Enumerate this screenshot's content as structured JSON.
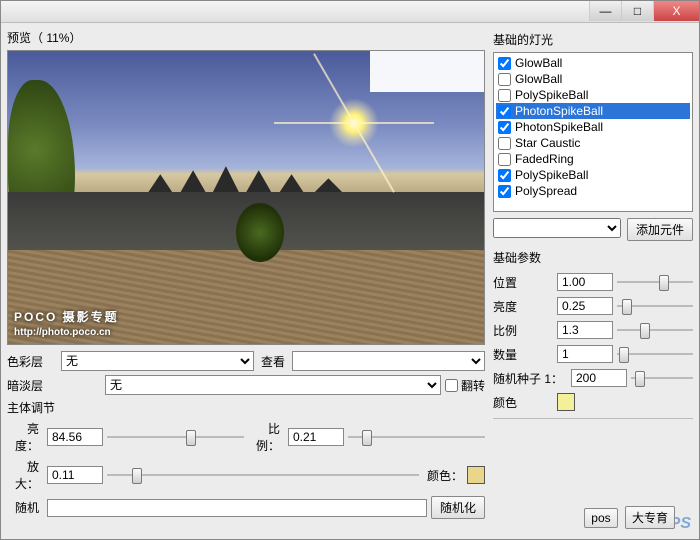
{
  "titlebar": {
    "minimize": "—",
    "maximize": "□",
    "close": "X"
  },
  "left": {
    "preview_label": "预览（  11%）",
    "watermark_title": "POCO 摄影专题",
    "watermark_url": "http://photo.poco.cn",
    "color_layer_label": "色彩层",
    "color_layer_value": "无",
    "view_label": "查看",
    "dim_layer_label": "暗淡层",
    "dim_layer_value": "无",
    "flip_label": "翻转",
    "main_adjust_label": "主体调节",
    "brightness_label": "亮度：",
    "brightness_value": "84.56",
    "ratio_label": "比例：",
    "ratio_value": "0.21",
    "zoom_label": "放大：",
    "zoom_value": "0.11",
    "color_label": "颜色：",
    "color_swatch": "#e9d68b",
    "random_label": "随机",
    "randomize_btn": "随机化"
  },
  "right": {
    "panel_title": "基础的灯光",
    "lights": [
      {
        "checked": true,
        "label": "GlowBall",
        "selected": false
      },
      {
        "checked": false,
        "label": "GlowBall",
        "selected": false
      },
      {
        "checked": false,
        "label": "PolySpikeBall",
        "selected": false
      },
      {
        "checked": true,
        "label": "PhotonSpikeBall",
        "selected": true
      },
      {
        "checked": true,
        "label": "PhotonSpikeBall",
        "selected": false
      },
      {
        "checked": false,
        "label": "Star Caustic",
        "selected": false
      },
      {
        "checked": false,
        "label": "FadedRing",
        "selected": false
      },
      {
        "checked": true,
        "label": "PolySpikeBall",
        "selected": false
      },
      {
        "checked": true,
        "label": "PolySpread",
        "selected": false
      }
    ],
    "add_btn": "添加元件",
    "basic_params_label": "基础参数",
    "position_label": "位置",
    "position_value": "1.00",
    "brightness_label": "亮度",
    "brightness_value": "0.25",
    "ratio_label": "比例",
    "ratio_value": "1.3",
    "count_label": "数量",
    "count_value": "1",
    "seed_label": "随机种子 1：",
    "seed_value": "200",
    "color_label": "颜色",
    "color_swatch": "#f4f09a",
    "footer_btn1": "pos",
    "footer_btn2": "大专育"
  }
}
